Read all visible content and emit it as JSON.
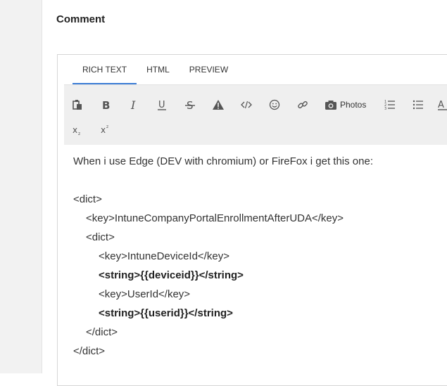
{
  "comment": {
    "title": "Comment"
  },
  "tabs": [
    {
      "label": "RICH TEXT",
      "active": true
    },
    {
      "label": "HTML",
      "active": false
    },
    {
      "label": "PREVIEW",
      "active": false
    }
  ],
  "toolbar": {
    "photos_label": "Photos",
    "icons": [
      "paste-icon",
      "bold-icon",
      "italic-icon",
      "underline-icon",
      "strikethrough-icon",
      "warning-icon",
      "code-icon",
      "emoji-icon",
      "link-icon",
      "camera-icon",
      "numbered-list-icon",
      "bulleted-list-icon",
      "font-color-icon",
      "subscript-icon",
      "superscript-icon"
    ]
  },
  "body": {
    "intro": "When i use Edge (DEV with chromium) or FireFox i get this one:",
    "lines": [
      "<dict>",
      "<key>IntuneCompanyPortalEnrollmentAfterUDA</key>",
      "<dict>",
      "<key>IntuneDeviceId</key>",
      "<string>{{deviceid}}</string>",
      "<key>UserId</key>",
      "<string>{{userid}}</string>",
      "</dict>",
      "</dict>"
    ]
  },
  "colors": {
    "tab_underline": "#3a7bd5",
    "toolbar_bg": "#efefef",
    "sidebar_bg": "#f2f2f2"
  }
}
